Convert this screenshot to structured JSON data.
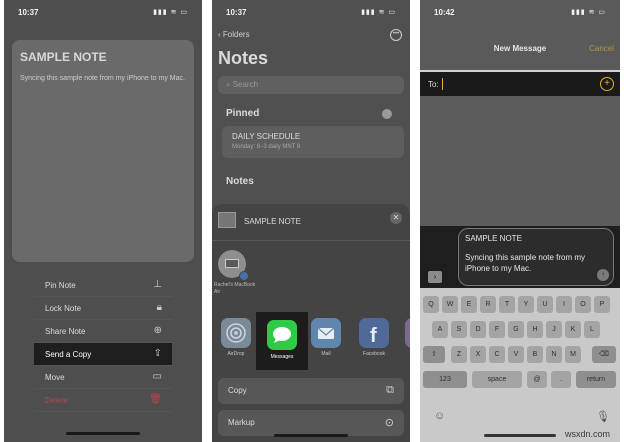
{
  "panel1": {
    "status": {
      "time": "10:37",
      "icons": "▮▮▮ ≋ ▭"
    },
    "note": {
      "title": "SAMPLE NOTE",
      "body": "Syncing this sample note from my iPhone to my Mac."
    },
    "menu": [
      {
        "label": "Pin Note",
        "icon": "pin-icon",
        "glyph": "⊥"
      },
      {
        "label": "Lock Note",
        "icon": "lock-icon",
        "glyph": "🔒︎"
      },
      {
        "label": "Share Note",
        "icon": "share-note-icon",
        "glyph": "⊕"
      },
      {
        "label": "Send a Copy",
        "icon": "share-icon",
        "glyph": "⇪"
      },
      {
        "label": "Move",
        "icon": "folder-icon",
        "glyph": "▭"
      },
      {
        "label": "Delete",
        "icon": "trash-icon",
        "glyph": "🗑︎"
      }
    ]
  },
  "panel2": {
    "status": {
      "time": "10:37",
      "icons": "▮▮▮ ≋ ▭"
    },
    "back": "‹ Folders",
    "more": "•••",
    "title": "Notes",
    "search_placeholder": "⌕ Search",
    "pinned_label": "Pinned",
    "pinned_note": {
      "title": "DAILY SCHEDULE",
      "subtitle": "Monday: 8–3 daily MNT 8"
    },
    "notes_label": "Notes",
    "share": {
      "note_name": "SAMPLE NOTE",
      "close": "✕",
      "device_label": "Rachel's MacBook Air",
      "apps": [
        "AirDrop",
        "Messages",
        "Mail",
        "Facebook",
        "M"
      ],
      "actions": [
        {
          "label": "Copy",
          "glyph": "⧉"
        },
        {
          "label": "Markup",
          "glyph": "⊙"
        }
      ]
    }
  },
  "panel3": {
    "status": {
      "time": "10:42",
      "icons": "▮▮▮ ≋ ▭"
    },
    "title": "New Message",
    "cancel": "Cancel",
    "to_label": "To:",
    "add": "+",
    "expand": "›",
    "bubble_title": "SAMPLE NOTE",
    "bubble_body": "Syncing this sample note from my iPhone to my Mac.",
    "send": "↑",
    "keyboard": {
      "row1": [
        "Q",
        "W",
        "E",
        "R",
        "T",
        "Y",
        "U",
        "I",
        "O",
        "P"
      ],
      "row2": [
        "A",
        "S",
        "D",
        "F",
        "G",
        "H",
        "J",
        "K",
        "L"
      ],
      "row3": [
        "Z",
        "X",
        "C",
        "V",
        "B",
        "N",
        "M"
      ],
      "shift": "⇧",
      "backspace": "⌫",
      "numbers": "123",
      "space": "space",
      "at": "@",
      "period": ".",
      "return": "return",
      "emoji": "☺",
      "mic": "🎙︎"
    }
  },
  "watermark": "wsxdn.com",
  "colors": {
    "highlight": "#1e1e1e",
    "messages_green": "#2fca48",
    "cancel_gold": "#b59a3a",
    "caret_gold": "#e0b330",
    "delete_red": "#b04a4a"
  }
}
